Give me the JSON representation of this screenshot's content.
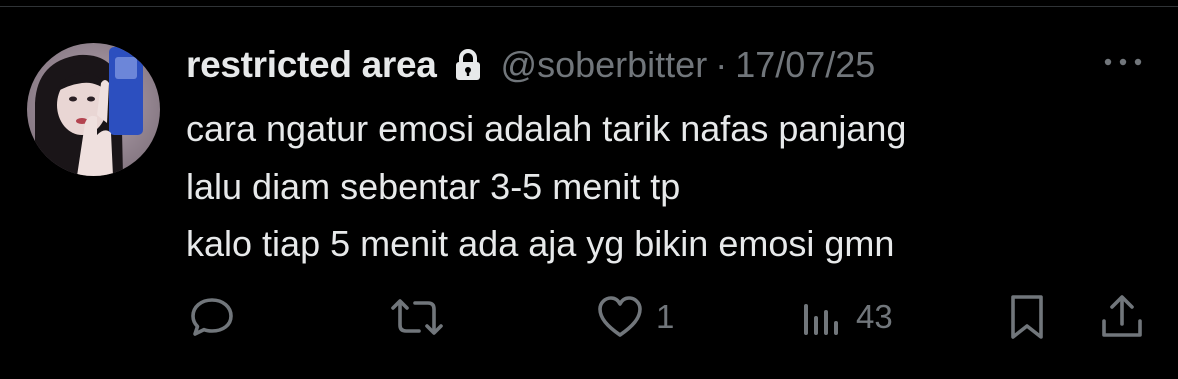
{
  "tweet": {
    "author": {
      "display_name": "restricted area",
      "handle": "@soberbitter",
      "protected_icon": "lock-icon"
    },
    "separator": "·",
    "date": "17/07/25",
    "more_icon": "more-horizontal-icon",
    "text_lines": [
      "cara ngatur emosi adalah tarik nafas panjang",
      "lalu diam sebentar 3-5 menit tp",
      "kalo tiap 5 menit ada aja yg bikin emosi gmn"
    ]
  },
  "actions": {
    "reply": {
      "icon": "reply-icon",
      "count": ""
    },
    "repost": {
      "icon": "repost-icon",
      "count": ""
    },
    "like": {
      "icon": "heart-icon",
      "count": "1"
    },
    "views": {
      "icon": "views-icon",
      "count": "43"
    },
    "bookmark": {
      "icon": "bookmark-icon"
    },
    "share": {
      "icon": "share-icon"
    }
  },
  "colors": {
    "background": "#000000",
    "text_primary": "#e7e9ea",
    "text_secondary": "#71767b",
    "divider": "#2f3336"
  }
}
